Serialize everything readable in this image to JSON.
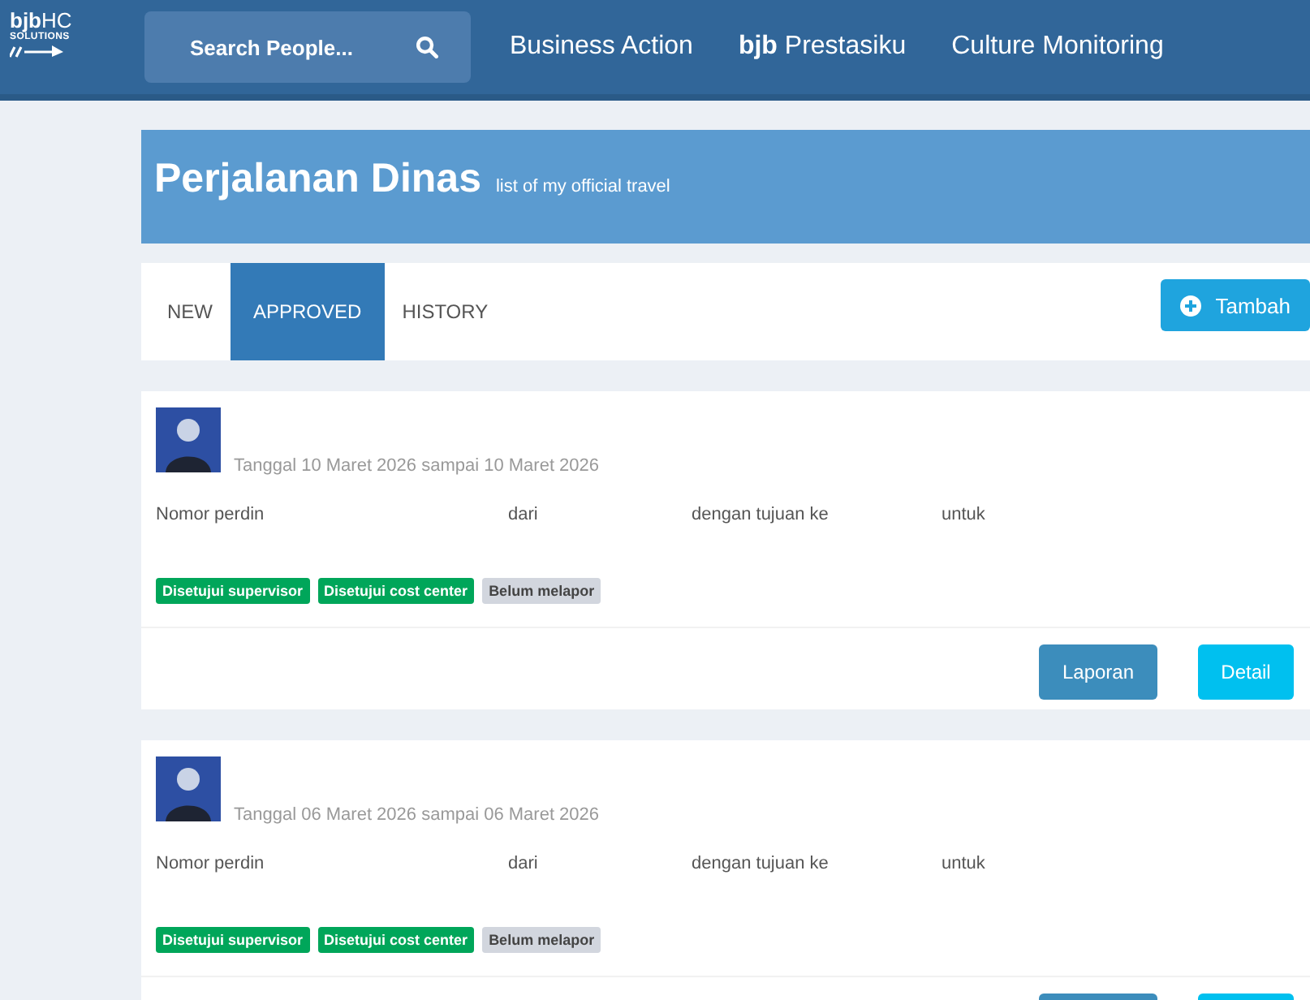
{
  "navbar": {
    "logo": {
      "brand": "bjb",
      "suffix": "HC",
      "tagline": "SOLUTIONS"
    },
    "search": {
      "placeholder": "Search People..."
    },
    "links": [
      {
        "label": "Business Action"
      },
      {
        "brand": "bjb",
        "label": "Prestasiku"
      },
      {
        "label": "Culture Monitoring"
      }
    ]
  },
  "header": {
    "title": "Perjalanan Dinas",
    "subtitle": "list of my official travel"
  },
  "tabs": [
    {
      "label": "NEW",
      "selected": false
    },
    {
      "label": "APPROVED",
      "selected": true
    },
    {
      "label": "HISTORY",
      "selected": false
    }
  ],
  "add_button": {
    "label": "Tambah"
  },
  "travels": [
    {
      "date": "Tanggal 10 Maret 2026 sampai 10 Maret 2026",
      "fields": [
        "Nomor perdin",
        "dari",
        "dengan tujuan ke",
        "untuk"
      ],
      "badges": [
        {
          "label": "Disetujui supervisor",
          "kind": "approved"
        },
        {
          "label": "Disetujui cost center",
          "kind": "approved"
        },
        {
          "label": "Belum melapor",
          "kind": "pending"
        }
      ],
      "actions": [
        {
          "kind": "report",
          "label": "Laporan"
        },
        {
          "kind": "detail",
          "label": "Detail"
        }
      ]
    },
    {
      "date": "Tanggal 06 Maret 2026 sampai 06 Maret 2026",
      "fields": [
        "Nomor perdin",
        "dari",
        "dengan tujuan ke",
        "untuk"
      ],
      "badges": [
        {
          "label": "Disetujui supervisor",
          "kind": "approved"
        },
        {
          "label": "Disetujui cost center",
          "kind": "approved"
        },
        {
          "label": "Belum melapor",
          "kind": "pending"
        }
      ],
      "actions": [
        {
          "kind": "report"
        },
        {
          "kind": "detail"
        }
      ]
    }
  ]
}
